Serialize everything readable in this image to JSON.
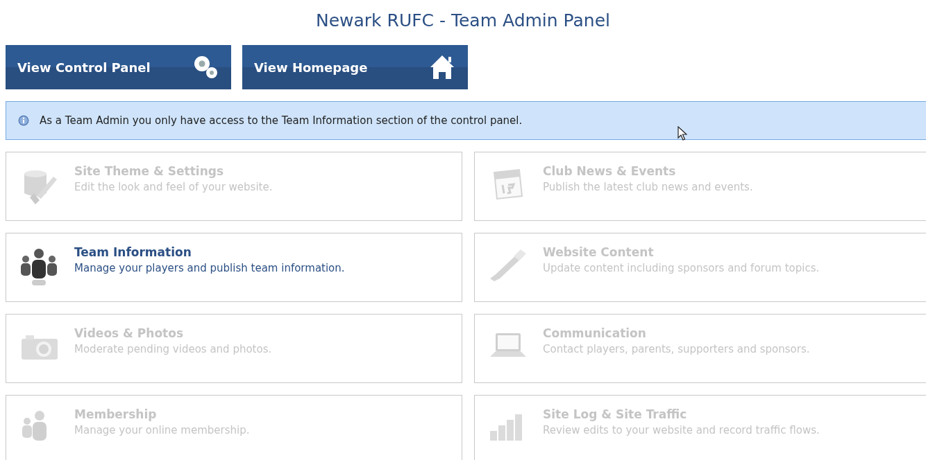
{
  "page": {
    "title": "Newark RUFC - Team Admin Panel"
  },
  "buttons": [
    {
      "label": "View Control Panel",
      "kind": "gears"
    },
    {
      "label": "View Homepage",
      "kind": "house"
    }
  ],
  "notice": {
    "text": "As a Team Admin you only have access to the Team Information section of the control panel."
  },
  "sections": [
    {
      "title": "Site Theme & Settings",
      "description": "Edit the look and feel of your website.",
      "kind": "paint",
      "disabled": true
    },
    {
      "title": "Club News & Events",
      "description": "Publish the latest club news and events.",
      "kind": "calendar",
      "disabled": true
    },
    {
      "title": "Team Information",
      "description": "Manage your players and publish team information.",
      "kind": "team",
      "disabled": false
    },
    {
      "title": "Website Content",
      "description": "Update content including sponsors and forum topics.",
      "kind": "pen",
      "disabled": true
    },
    {
      "title": "Videos & Photos",
      "description": "Moderate pending videos and photos.",
      "kind": "camera",
      "disabled": true
    },
    {
      "title": "Communication",
      "description": "Contact players, parents, supporters and sponsors.",
      "kind": "laptop",
      "disabled": true
    },
    {
      "title": "Membership",
      "description": "Manage your online membership.",
      "kind": "members",
      "disabled": true
    },
    {
      "title": "Site Log & Site Traffic",
      "description": "Review edits to your website and record traffic flows.",
      "kind": "chart",
      "disabled": true
    }
  ]
}
